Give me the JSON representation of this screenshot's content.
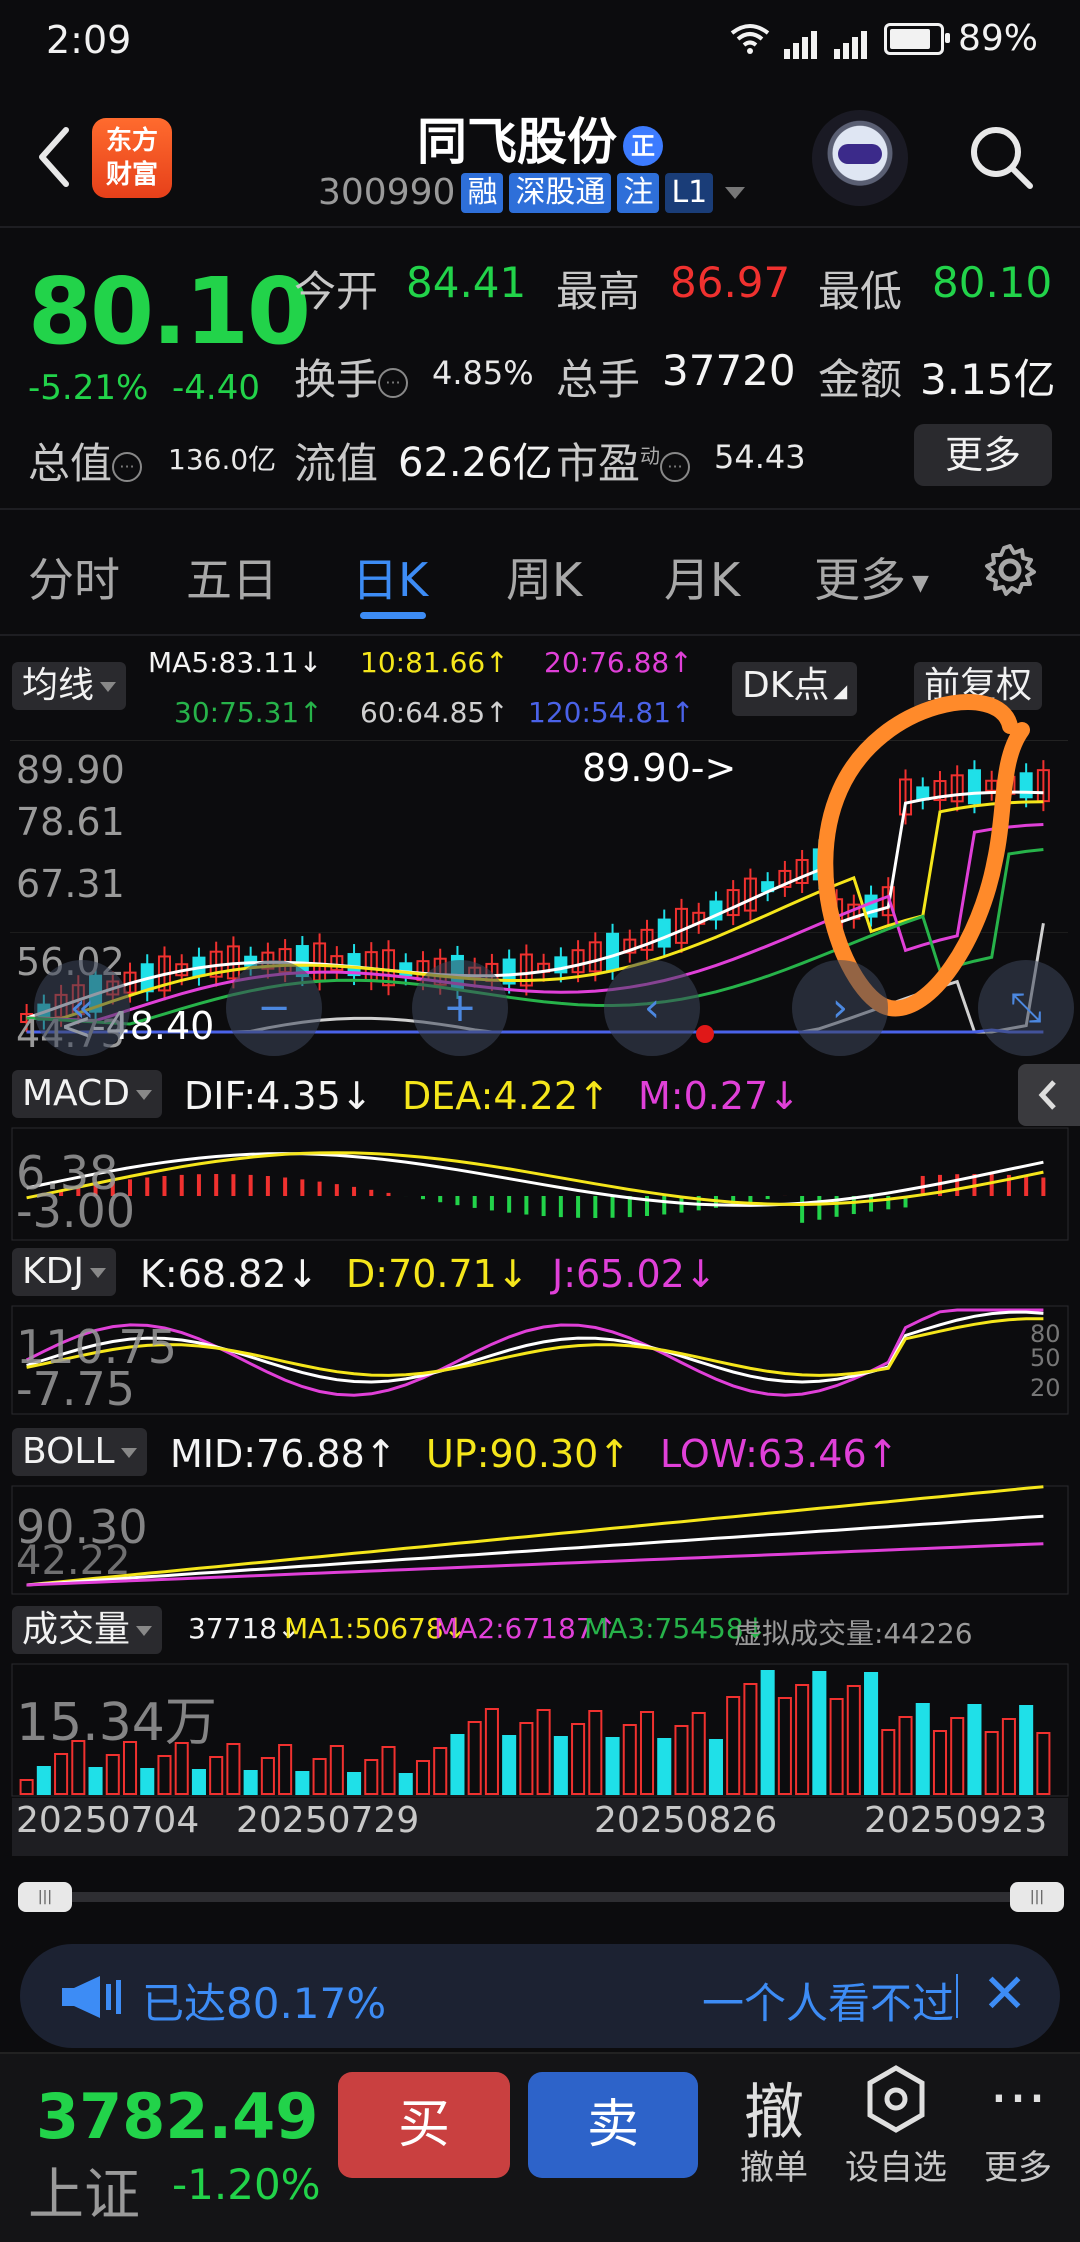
{
  "status": {
    "time": "2:09",
    "network": "4G",
    "battery": "89%"
  },
  "header": {
    "logo_line1": "东方",
    "logo_line2": "财富",
    "stock_name": "同飞股份",
    "badge": "正",
    "code": "300990",
    "tags": [
      "融",
      "深股通",
      "注",
      "L1"
    ]
  },
  "quote": {
    "price": "80.10",
    "change_pct": "-5.21%",
    "change_amt": "-4.40",
    "open_label": "今开",
    "open": "84.41",
    "high_label": "最高",
    "high": "86.97",
    "low_label": "最低",
    "low": "80.10",
    "turnover_label": "换手",
    "turnover": "4.85%",
    "volume_label": "总手",
    "volume": "37720",
    "amount_label": "金额",
    "amount": "3.15亿",
    "mktcap_label": "总值",
    "mktcap": "136.0亿",
    "float_label": "流值",
    "float": "62.26亿",
    "pe_label": "市盈",
    "pe_sup": "动",
    "pe": "54.43",
    "more": "更多"
  },
  "tabs": [
    "分时",
    "五日",
    "日K",
    "周K",
    "月K",
    "更多"
  ],
  "active_tab": "日K",
  "chart": {
    "ma_btn": "均线",
    "ma": {
      "ma5": "MA5:83.11↓",
      "ma10": "10:81.66↑",
      "ma20": "20:76.88↑",
      "ma30": "30:75.31↑",
      "ma60": "60:64.85↑",
      "ma120": "120:54.81↑"
    },
    "dk_btn": "DK点",
    "fq_btn": "前复权",
    "price_axis": [
      "89.90",
      "78.61",
      "67.31",
      "56.02",
      "44.73"
    ],
    "high_marker": "89.90->",
    "low_marker": "<-48.40",
    "macd": {
      "name": "MACD",
      "dif": "DIF:4.35↓",
      "dea": "DEA:4.22↑",
      "m": "M:0.27↓",
      "axis_top": "6.38",
      "axis_bottom": "-3.00"
    },
    "kdj": {
      "name": "KDJ",
      "k": "K:68.82↓",
      "d": "D:70.71↓",
      "j": "J:65.02↓",
      "axis_top": "110.75",
      "axis_bottom": "-7.75",
      "levels": [
        "80",
        "50",
        "20"
      ]
    },
    "boll": {
      "name": "BOLL",
      "mid": "MID:76.88↑",
      "up": "UP:90.30↑",
      "low": "LOW:63.46↑",
      "axis_top": "90.30",
      "axis_bottom": "42.22"
    },
    "vol": {
      "name": "成交量",
      "v": "37718↓",
      "ma1": "MA1:50678↓",
      "ma2": "MA2:67187↑",
      "ma3": "MA3:75458↓",
      "virtual": "虚拟成交量:44226",
      "axis_top": "15.34万"
    },
    "dates": [
      "20250704",
      "20250729",
      "20250826",
      "20250923"
    ]
  },
  "notice": {
    "text1": "已达80.17%",
    "text2": "一个人看不过"
  },
  "bottom": {
    "index_value": "3782.49",
    "index_name": "上证",
    "index_change": "-1.20%",
    "buy": "买",
    "sell": "卖",
    "cancel_icon": "撤",
    "cancel_label": "撤单",
    "watch_label": "设自选",
    "more_label": "更多"
  },
  "colors": {
    "up": "#f0312f",
    "down": "#22d34a",
    "accent": "#3d8cf5",
    "annotation": "#ff8a2a"
  }
}
